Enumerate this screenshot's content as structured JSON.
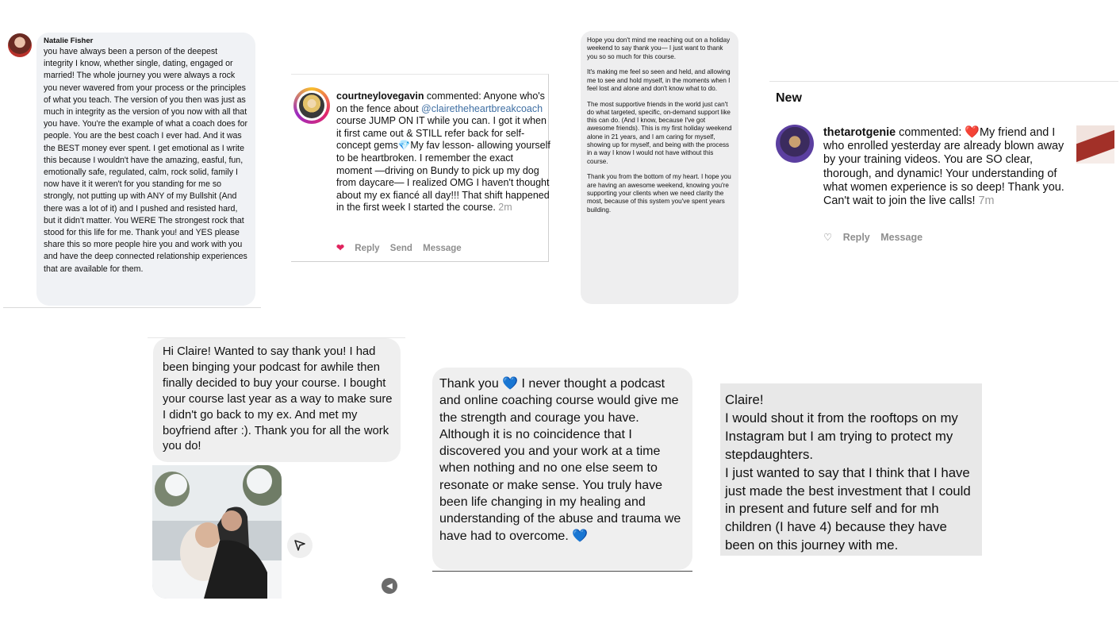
{
  "card1": {
    "name": "Natalie Fisher",
    "text": "you have always been a person of the deepest integrity I know, whether single, dating, engaged or married! The whole journey you were always a rock you never wavered from your process or the principles of what you teach. The version of you then was just as much in integrity as the version of you now with all that you have. You're the example of what a coach does for people. You are the best coach I ever had. And it was the BEST money ever spent. I get emotional as I write this because I wouldn't have the amazing, easful, fun, emotionally safe, regulated, calm, rock solid, family I now have it it weren't for you standing for me so strongly, not putting up with ANY of my Bullshit (And there was a lot of it) and I pushed and resisted hard, but it didn't matter. You WERE The strongest rock that stood for this life for me. Thank you! and YES please share this so more people hire you and work with you and have the deep connected relationship experiences that are available for them."
  },
  "card2": {
    "username": "courtneylovegavin",
    "commented": " commented: Anyone who's on the fence about ",
    "mention": "@claire​theheartbreakcoach",
    "text": " course JUMP ON IT while you can. I got it when it first came out & STILL refer back for self-concept gems💎My fav lesson- allowing yourself to be heartbroken. I remember the exact moment —driving on Bundy to pick up my dog from daycare— I realized OMG I haven't thought about my ex fiancé all day!!! That shift happened in the first week I started the course. ",
    "time": "2m",
    "actions": [
      "Reply",
      "Send",
      "Message"
    ]
  },
  "card3": {
    "paragraphs": [
      "Hope you don't mind me reaching out on a holiday weekend to say thank you— I just want to thank you so so much for this course.",
      "It's making me feel so seen and held, and allowing me to see and hold myself, in the moments when I feel lost and alone and don't know what to do.",
      "The most supportive friends in the world just can't do what targeted, specific, on-demand support like this can do. (And I know, because I've got awesome friends). This is my first holiday weekend alone in 21 years, and I am caring for myself, showing up for myself, and being with the process in a way I know I would not have without this course.",
      "Thank you from the bottom of my heart. I hope you are having an awesome weekend, knowing you're supporting your clients when we need clarity the most, because of this system you've spent years building."
    ]
  },
  "card4": {
    "header": "New",
    "username": "thetarotgenie",
    "commented": " commented: ",
    "text": "My friend and I who enrolled yesterday are already blown away by your training videos. You are SO clear, thorough, and dynamic!  Your understanding of what women experience is so deep!  Thank you.  Can't wait to join the live calls! ",
    "time": "7m",
    "actions": [
      "Reply",
      "Message"
    ]
  },
  "card5": {
    "text": "Hi Claire! Wanted to say thank you! I had been binging your podcast for awhile then finally decided to buy your course. I bought your course last year as a way to make sure I didn't go back to my ex. And met my boyfriend after :). Thank you for all the work you do!"
  },
  "card6": {
    "lead": "Thank you ",
    "text": " I never thought a podcast and online coaching course would give me the strength and courage you have. Although it is no coincidence that I discovered you and your work at a time when nothing and no one else seem to resonate or make sense. You truly have been life changing in my healing and understanding of the abuse and trauma we have had to overcome. "
  },
  "card7": {
    "lines": [
      "Claire!",
      "I would shout it from the rooftops on my Instagram but I am trying to protect my stepdaughters.",
      "I just wanted to say that I think that I have just made the best investment that I could in present and future self and for mh children (I have 4) because they have been on this journey with me."
    ]
  },
  "colors": {
    "ig_heart": "#e0245e",
    "blue_heart": "#1f77d8",
    "mention": "#3f6fa3"
  },
  "icons": [
    "heart-icon",
    "heart-outline-icon",
    "gem-icon",
    "blue-heart-icon",
    "send-icon",
    "sound-icon"
  ]
}
